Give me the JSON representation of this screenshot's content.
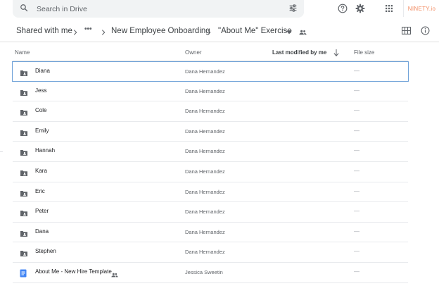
{
  "search": {
    "placeholder": "Search in Drive"
  },
  "logo": {
    "text": "NINETY.io"
  },
  "breadcrumbs": {
    "root": "Shared with me",
    "more": "•••",
    "folder": "New Employee Onboarding",
    "current": "\"About Me\" Exercise"
  },
  "columns": {
    "name": "Name",
    "owner": "Owner",
    "modified": "Last modified by me",
    "size": "File size"
  },
  "colors": {
    "folder": "#5f6368",
    "doc": "#4285f4",
    "selection": "#6ea1d8"
  },
  "files": [
    {
      "name": "Diana",
      "owner": "Dana Hernandez",
      "size": "—",
      "type": "folder-icon"
    },
    {
      "name": "Jess",
      "owner": "Dana Hernandez",
      "size": "—",
      "type": "folder-icon"
    },
    {
      "name": "Cole",
      "owner": "Dana Hernandez",
      "size": "—",
      "type": "folder-icon"
    },
    {
      "name": "Emily",
      "owner": "Dana Hernandez",
      "size": "—",
      "type": "folder-icon"
    },
    {
      "name": "Hannah",
      "owner": "Dana Hernandez",
      "size": "—",
      "type": "folder-icon"
    },
    {
      "name": "Kara",
      "owner": "Dana Hernandez",
      "size": "—",
      "type": "folder-icon"
    },
    {
      "name": "Eric",
      "owner": "Dana Hernandez",
      "size": "—",
      "type": "folder-icon"
    },
    {
      "name": "Peter",
      "owner": "Dana Hernandez",
      "size": "—",
      "type": "folder-icon"
    },
    {
      "name": "Dana",
      "owner": "Dana Hernandez",
      "size": "—",
      "type": "folder-icon"
    },
    {
      "name": "Stephen",
      "owner": "Dana Hernandez",
      "size": "—",
      "type": "folder-icon"
    },
    {
      "name": "About Me - New Hire Template",
      "owner": "Jessica Sweetin",
      "size": "—",
      "type": "doc-icon"
    }
  ]
}
